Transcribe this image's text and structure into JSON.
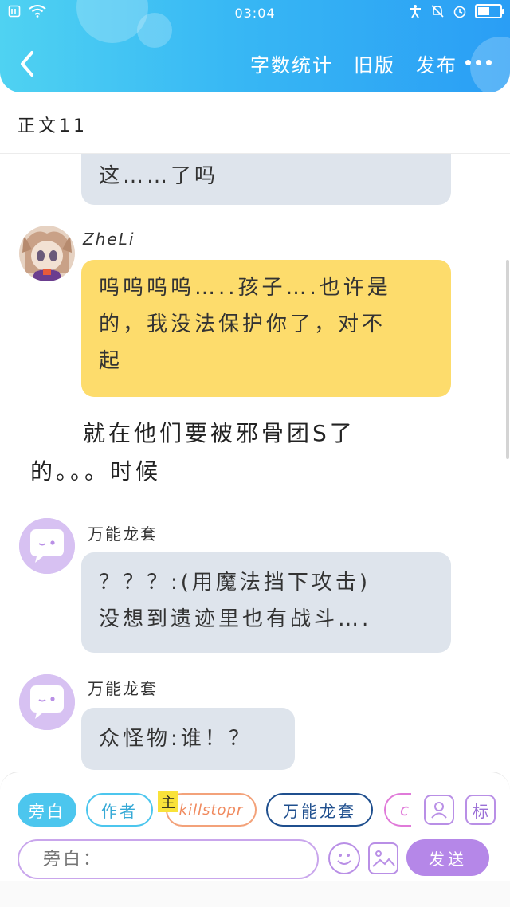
{
  "status_bar": {
    "time": "03:04"
  },
  "nav": {
    "actions": [
      "字数统计",
      "旧版",
      "发布"
    ]
  },
  "section": {
    "title": "正文11"
  },
  "messages": [
    {
      "type": "bubble",
      "style": "gray",
      "speaker": "",
      "text": "这……了吗"
    },
    {
      "type": "bubble",
      "style": "yellow",
      "speaker": "ZheLi",
      "lines": [
        "呜呜呜呜…..孩子….也许是",
        "的，我没法保护你了，对不",
        "起"
      ]
    },
    {
      "type": "narration",
      "lines": [
        "就在他们要被邪骨团S了",
        "的。。。时候"
      ]
    },
    {
      "type": "bubble",
      "style": "gray",
      "speaker": "万能龙套",
      "lines": [
        "？？？:(用魔法挡下攻击)",
        "没想到遗迹里也有战斗…."
      ]
    },
    {
      "type": "bubble",
      "style": "gray",
      "speaker": "万能龙套",
      "lines": [
        "众怪物:谁！？"
      ]
    }
  ],
  "composer": {
    "chips": [
      "旁白",
      "作者",
      "killstopr",
      "万能龙套",
      "ch"
    ],
    "host_tag": "主",
    "tag_label": "标",
    "input_placeholder": "旁白：",
    "send_label": "发送"
  },
  "colors": {
    "header_gradient_start": "#4fd2f2",
    "header_gradient_end": "#2a9ef5",
    "bubble_gray": "#dee4ec",
    "bubble_yellow": "#fddc6c",
    "accent_purple": "#b587e8",
    "chip_blue": "#4cc6ee"
  }
}
